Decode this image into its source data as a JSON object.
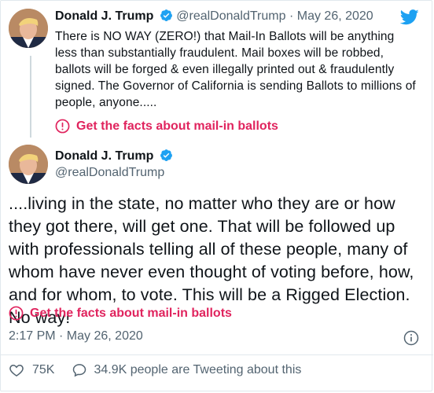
{
  "tweet1": {
    "name": "Donald J. Trump",
    "handle": "@realDonaldTrump",
    "separator": "·",
    "date": "May 26, 2020",
    "text": "There is NO WAY (ZERO!) that Mail-In Ballots will be anything less than substantially fraudulent. Mail boxes will be robbed, ballots will be forged & even illegally printed out & fraudulently signed. The Governor of California is sending Ballots to millions of people, anyone.....",
    "warning": "Get the facts about mail-in ballots"
  },
  "tweet2": {
    "name": "Donald J. Trump",
    "handle": "@realDonaldTrump",
    "text": "....living in the state, no matter who they are or how they got there, will get one. That will be followed up with professionals telling all of these people, many of whom have never even thought of voting before, how, and for whom, to vote. This will be a Rigged Election. No way!",
    "warning": "Get the facts about mail-in ballots",
    "timestamp": "2:17 PM · May 26, 2020"
  },
  "stats": {
    "likes": "75K",
    "tweeting": "34.9K people are Tweeting about this"
  },
  "colors": {
    "accent_blue": "#1da1f2",
    "warning_pink": "#e0245e",
    "muted": "#536471"
  }
}
